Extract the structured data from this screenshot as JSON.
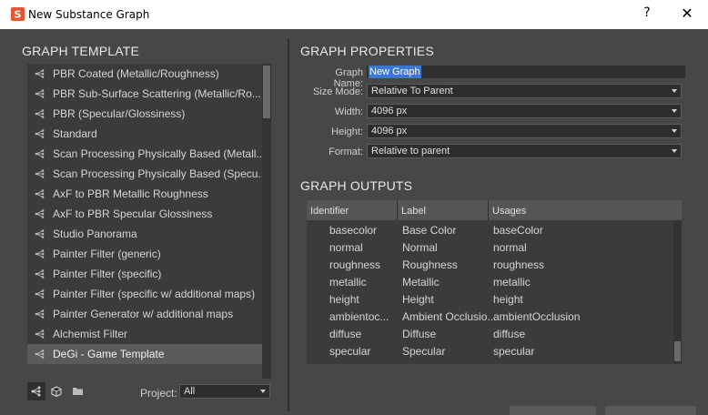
{
  "window": {
    "title": "New Substance Graph",
    "help_label": "?",
    "close_label": "✕"
  },
  "template_panel": {
    "title": "GRAPH TEMPLATE",
    "items": [
      {
        "label": "PBR Coated (Metallic/Roughness)",
        "selected": false
      },
      {
        "label": "PBR Sub-Surface Scattering (Metallic/Ro...",
        "selected": false
      },
      {
        "label": "PBR (Specular/Glossiness)",
        "selected": false
      },
      {
        "label": "Standard",
        "selected": false
      },
      {
        "label": "Scan Processing Physically Based (Metall...",
        "selected": false
      },
      {
        "label": "Scan Processing Physically Based (Specu...",
        "selected": false
      },
      {
        "label": "AxF to PBR Metallic Roughness",
        "selected": false
      },
      {
        "label": "AxF to PBR Specular Glossiness",
        "selected": false
      },
      {
        "label": "Studio Panorama",
        "selected": false
      },
      {
        "label": "Painter Filter (generic)",
        "selected": false
      },
      {
        "label": "Painter Filter (specific)",
        "selected": false
      },
      {
        "label": "Painter Filter (specific w/ additional maps)",
        "selected": false
      },
      {
        "label": "Painter Generator w/ additional maps",
        "selected": false
      },
      {
        "label": "Alchemist Filter",
        "selected": false
      },
      {
        "label": "DeGi - Game Template",
        "selected": true
      }
    ],
    "bottom_icons": [
      "graph-view-icon",
      "cube-icon",
      "folder-icon"
    ],
    "project_label": "Project:",
    "project_value": "All"
  },
  "properties": {
    "title": "GRAPH PROPERTIES",
    "graph_name_label": "Graph Name:",
    "graph_name_value": "New Graph",
    "size_mode_label": "Size Mode:",
    "size_mode_value": "Relative To Parent",
    "width_label": "Width:",
    "width_value": "4096 px",
    "height_label": "Height:",
    "height_value": "4096 px",
    "format_label": "Format:",
    "format_value": "Relative to parent"
  },
  "outputs": {
    "title": "GRAPH OUTPUTS",
    "columns": [
      "Identifier",
      "Label",
      "Usages"
    ],
    "rows": [
      [
        "basecolor",
        "Base Color",
        "baseColor"
      ],
      [
        "normal",
        "Normal",
        "normal"
      ],
      [
        "roughness",
        "Roughness",
        "roughness"
      ],
      [
        "metallic",
        "Metallic",
        "metallic"
      ],
      [
        "height",
        "Height",
        "height"
      ],
      [
        "ambientoc...",
        "Ambient Occlusio...",
        "ambientOcclusion"
      ],
      [
        "diffuse",
        "Diffuse",
        "diffuse"
      ],
      [
        "specular",
        "Specular",
        "specular"
      ]
    ]
  },
  "colors": {
    "selection": "#3a78d4",
    "panel_bg": "#474747",
    "list_bg": "#3b3b3b",
    "selected_row": "#5a5a5a"
  }
}
